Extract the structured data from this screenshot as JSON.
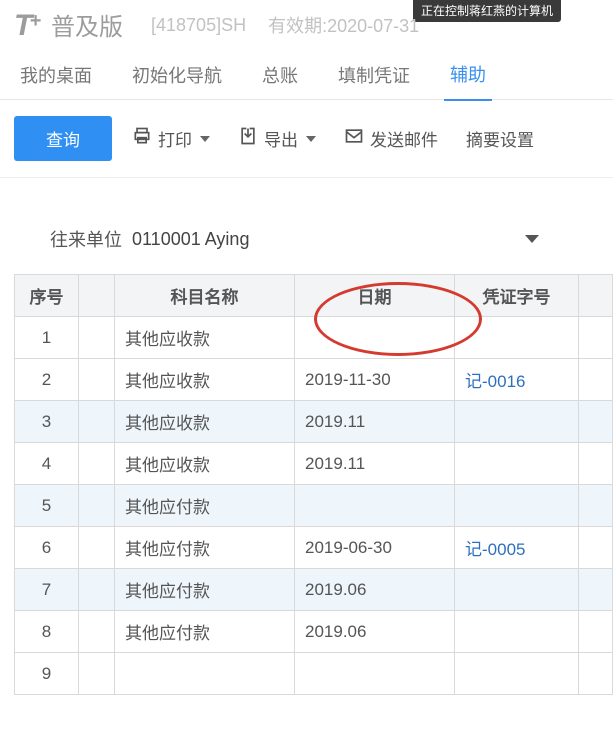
{
  "remote_banner": "正在控制蒋红燕的计算机",
  "brand": {
    "t": "T",
    "plus": "+",
    "name": "普及版"
  },
  "header": {
    "org_code": "[418705]SH",
    "valid_label": "有效期:2020-07-31"
  },
  "nav": {
    "items": [
      {
        "label": "我的桌面",
        "active": false
      },
      {
        "label": "初始化导航",
        "active": false
      },
      {
        "label": "总账",
        "active": false
      },
      {
        "label": "填制凭证",
        "active": false
      },
      {
        "label": "辅助",
        "active": true
      }
    ]
  },
  "toolbar": {
    "query": "查询",
    "print": "打印",
    "export": "导出",
    "send_mail": "发送邮件",
    "summary": "摘要设置"
  },
  "filter": {
    "label": "往来单位",
    "value": "0110001 Aying"
  },
  "table": {
    "headers": {
      "seq": "序号",
      "name": "科目名称",
      "date": "日期",
      "voucher": "凭证字号"
    },
    "rows": [
      {
        "seq": "1",
        "name": "其他应收款",
        "date": "",
        "voucher": "",
        "alt": false
      },
      {
        "seq": "2",
        "name": "其他应收款",
        "date": "2019-11-30",
        "voucher": "记-0016",
        "alt": false
      },
      {
        "seq": "3",
        "name": "其他应收款",
        "date": "2019.11",
        "voucher": "",
        "alt": true
      },
      {
        "seq": "4",
        "name": "其他应收款",
        "date": "2019.11",
        "voucher": "",
        "alt": false
      },
      {
        "seq": "5",
        "name": "其他应付款",
        "date": "",
        "voucher": "",
        "alt": true
      },
      {
        "seq": "6",
        "name": "其他应付款",
        "date": "2019-06-30",
        "voucher": "记-0005",
        "alt": false
      },
      {
        "seq": "7",
        "name": "其他应付款",
        "date": "2019.06",
        "voucher": "",
        "alt": true
      },
      {
        "seq": "8",
        "name": "其他应付款",
        "date": "2019.06",
        "voucher": "",
        "alt": false
      },
      {
        "seq": "9",
        "name": "",
        "date": "",
        "voucher": "",
        "alt": false
      }
    ]
  }
}
